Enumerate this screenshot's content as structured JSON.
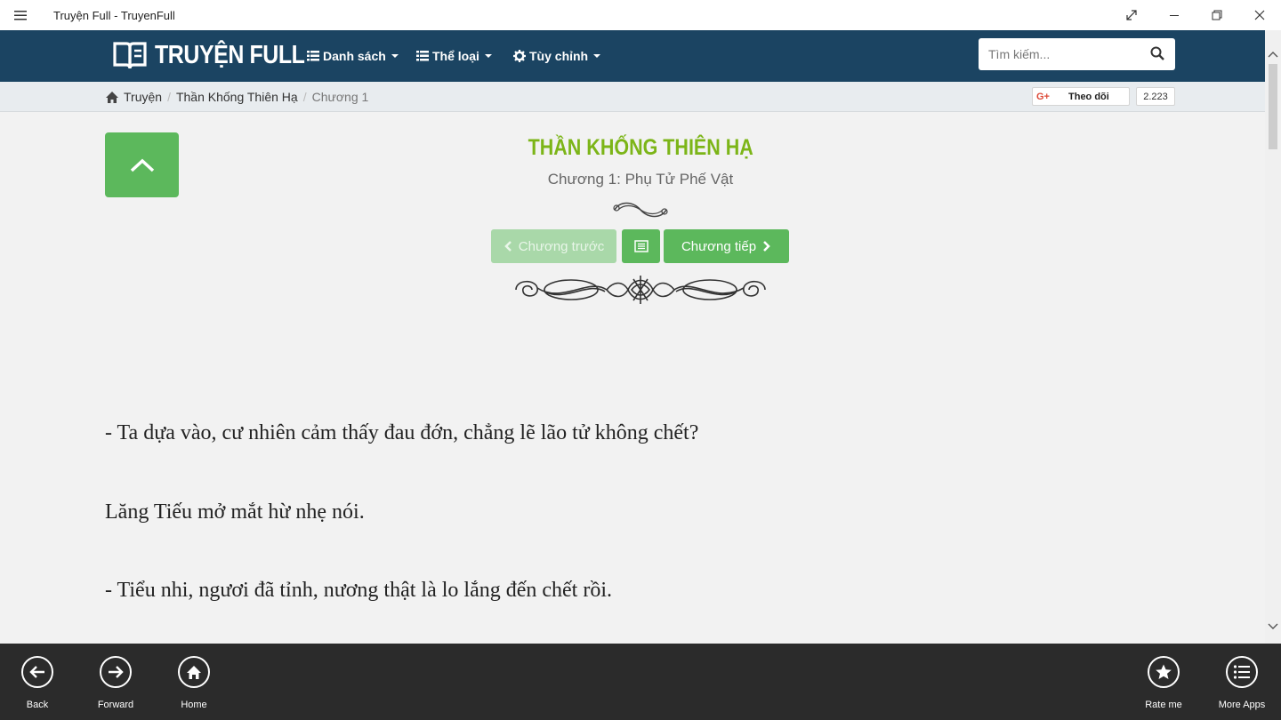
{
  "window": {
    "title": "Truyện Full - TruyenFull"
  },
  "navbar": {
    "brand": "TRUYỆN FULL",
    "menu": [
      {
        "label": "Danh sách",
        "icon": "list-icon"
      },
      {
        "label": "Thể loại",
        "icon": "list-icon"
      },
      {
        "label": "Tùy chỉnh",
        "icon": "gear-icon"
      }
    ],
    "search_placeholder": "Tìm kiếm..."
  },
  "breadcrumb": {
    "items": [
      "Truyện",
      "Thần Khống Thiên Hạ",
      "Chương 1"
    ]
  },
  "social": {
    "gplus": "G+",
    "follow_label": "Theo dõi",
    "follow_count": "2.223"
  },
  "story": {
    "title": "THẦN KHỐNG THIÊN HẠ",
    "chapter": "Chương 1: Phụ Tử Phế Vật"
  },
  "chapter_nav": {
    "prev_label": "Chương trước",
    "next_label": "Chương tiếp"
  },
  "content": {
    "paragraphs": [
      "- Ta dựa vào, cư nhiên cảm thấy đau đớn, chẳng lẽ lão tử không chết?",
      "Lăng Tiếu mở mắt hừ nhẹ nói.",
      "- Tiểu nhi, ngươi đã tỉnh, nương thật là lo lắng đến chết rồi."
    ]
  },
  "appbar": {
    "left": [
      "Back",
      "Forward",
      "Home"
    ],
    "right": [
      "Rate me",
      "More Apps"
    ]
  },
  "colors": {
    "navbar": "#1b4462",
    "accent_green": "#5cb85c",
    "title_green": "#7cb518",
    "appbar": "#2b2b2b"
  }
}
